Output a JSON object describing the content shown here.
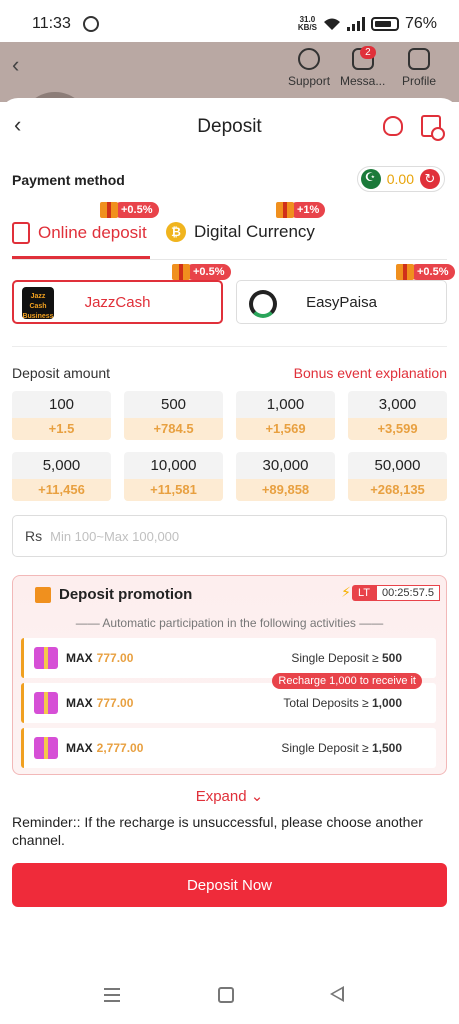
{
  "status_bar": {
    "time": "11:33",
    "net_speed": "31.0",
    "net_unit": "KB/S",
    "battery": "76%"
  },
  "behind_nav": {
    "support": "Support",
    "messages": "Messa...",
    "messages_badge": "2",
    "profile": "Profile"
  },
  "header": {
    "title": "Deposit"
  },
  "payment": {
    "label": "Payment method",
    "balance": "0.00"
  },
  "tabs": [
    {
      "label": "Online deposit",
      "bonus": "+0.5%",
      "icon": "phone-deposit-icon"
    },
    {
      "label": "Digital Currency",
      "bonus": "+1%",
      "icon": "coin-icon"
    }
  ],
  "channels": [
    {
      "name": "JazzCash",
      "bonus": "+0.5%",
      "logo_text": "JazzCash Business"
    },
    {
      "name": "EasyPaisa",
      "bonus": "+0.5%"
    }
  ],
  "amount": {
    "label": "Deposit amount",
    "bonus_link": "Bonus event explanation",
    "options": [
      {
        "value": "100",
        "bonus": "+1.5"
      },
      {
        "value": "500",
        "bonus": "+784.5"
      },
      {
        "value": "1,000",
        "bonus": "+1,569"
      },
      {
        "value": "3,000",
        "bonus": "+3,599"
      },
      {
        "value": "5,000",
        "bonus": "+11,456"
      },
      {
        "value": "10,000",
        "bonus": "+11,581"
      },
      {
        "value": "30,000",
        "bonus": "+89,858"
      },
      {
        "value": "50,000",
        "bonus": "+268,135"
      }
    ],
    "currency": "Rs",
    "placeholder": "Min 100~Max 100,000"
  },
  "promotion": {
    "title": "Deposit promotion",
    "timer_label": "LT",
    "timer": "00:25:57.5",
    "subtitle": "Automatic participation in the following activities",
    "rows": [
      {
        "max_label": "MAX",
        "max_value": "777.00",
        "cond": "Single Deposit ≥",
        "cond_value": "500"
      },
      {
        "max_label": "MAX",
        "max_value": "777.00",
        "cond": "Total Deposits ≥",
        "cond_value": "1,000",
        "tag": "Recharge 1,000 to receive it"
      },
      {
        "max_label": "MAX",
        "max_value": "2,777.00",
        "cond": "Single Deposit ≥",
        "cond_value": "1,500"
      }
    ]
  },
  "expand_label": "Expand",
  "reminder": "Reminder:: If the recharge is unsuccessful, please choose another channel.",
  "deposit_button": "Deposit Now",
  "colors": {
    "accent": "#e0303a",
    "bonus": "#e8a040",
    "bonus_bg": "#fdebd3"
  }
}
